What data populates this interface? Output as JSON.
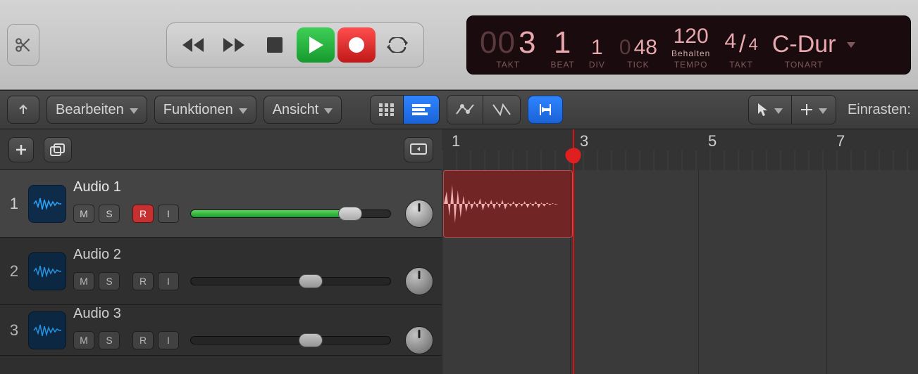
{
  "transport": {
    "position": {
      "bar_prefix": "00",
      "bar": "3",
      "beat": "1",
      "div": "1",
      "tick_prefix": "0",
      "tick": "48"
    },
    "labels": {
      "bar": "TAKT",
      "beat": "BEAT",
      "div": "DIV",
      "tick": "TICK",
      "tempo": "TEMPO",
      "tsig": "TAKT",
      "key": "TONART"
    },
    "tempo": {
      "value": "120",
      "mode": "Behalten"
    },
    "tsig": {
      "num": "4",
      "den": "4"
    },
    "key": "C-Dur"
  },
  "menus": {
    "edit": "Bearbeiten",
    "functions": "Funktionen",
    "view": "Ansicht"
  },
  "snap_label": "Einrasten:",
  "ruler": {
    "bars": [
      "1",
      "3",
      "5",
      "7"
    ]
  },
  "tracks": [
    {
      "num": "1",
      "name": "Audio 1",
      "m": "M",
      "s": "S",
      "r": "R",
      "i": "I",
      "rec_armed": true,
      "vol_pct": 80
    },
    {
      "num": "2",
      "name": "Audio 2",
      "m": "M",
      "s": "S",
      "r": "R",
      "i": "I",
      "rec_armed": false,
      "vol_pct": 60
    },
    {
      "num": "3",
      "name": "Audio 3",
      "m": "M",
      "s": "S",
      "r": "R",
      "i": "I",
      "rec_armed": false,
      "vol_pct": 60
    }
  ],
  "colors": {
    "accent_blue": "#2f84ff",
    "play_green": "#1faa34",
    "rec_red": "#d42020",
    "region_red": "#a01414"
  }
}
